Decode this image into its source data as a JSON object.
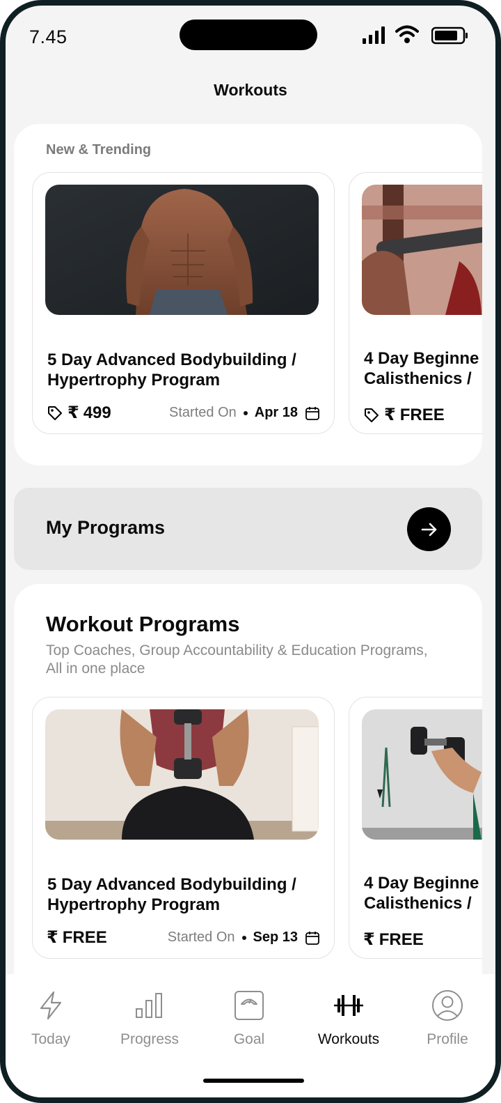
{
  "status_bar": {
    "time": "7.45"
  },
  "header": {
    "title": "Workouts"
  },
  "trending": {
    "label": "New & Trending",
    "cards": [
      {
        "title": "5 Day Advanced Bodybuilding /\nHypertrophy Program",
        "currency": "₹",
        "price": "499",
        "started_label": "Started On",
        "date": "Apr 18"
      },
      {
        "title": "4 Day Beginne\nCalisthenics / ",
        "currency": "₹",
        "price": "FREE"
      }
    ]
  },
  "my_programs": {
    "label": "My Programs"
  },
  "workout_programs": {
    "heading": "Workout Programs",
    "subtitle": "Top Coaches, Group Accountability & Education Programs, All in one place",
    "cards": [
      {
        "title": "5 Day Advanced Bodybuilding /\nHypertrophy Program",
        "currency": "₹",
        "price": "FREE",
        "started_label": "Started On",
        "date": "Sep 13"
      },
      {
        "title": "4 Day Beginne\nCalisthenics / ",
        "currency": "₹",
        "price": "FREE"
      }
    ]
  },
  "nav": {
    "items": [
      {
        "label": "Today",
        "icon": "lightning-icon"
      },
      {
        "label": "Progress",
        "icon": "bar-chart-icon"
      },
      {
        "label": "Goal",
        "icon": "scale-icon"
      },
      {
        "label": "Workouts",
        "icon": "dumbbell-icon",
        "active": true
      },
      {
        "label": "Profile",
        "icon": "profile-icon"
      }
    ]
  },
  "colors": {
    "background": "#f4f4f4",
    "card": "#ffffff",
    "accent": "#000000",
    "muted_text": "#7d7d7d",
    "frame": "#0f1f24"
  }
}
